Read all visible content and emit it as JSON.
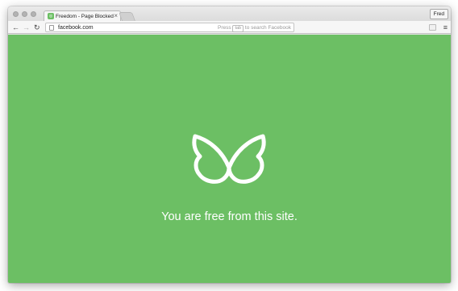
{
  "tab": {
    "title": "Freedom - Page Blocked",
    "close_glyph": "×",
    "favicon_text": "◎"
  },
  "profile": {
    "name": "Fred"
  },
  "toolbar": {
    "back_glyph": "←",
    "forward_glyph": "→",
    "reload_glyph": "↻",
    "url": "facebook.com",
    "hint_prefix": "Press",
    "hint_key": "tab",
    "hint_suffix": "to search Facebook",
    "menu_glyph": "≡"
  },
  "page": {
    "message": "You are free from this site.",
    "background_color": "#6cbf64",
    "icon": "butterfly-icon"
  }
}
